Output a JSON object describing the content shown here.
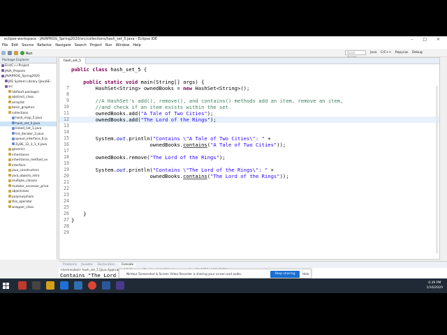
{
  "window": {
    "title": "eclipse-workspace - JAVAPROG_Spring2020/src/collections/hash_set_5.java - Eclipse IDE"
  },
  "menu": [
    "File",
    "Edit",
    "Source",
    "Refactor",
    "Navigate",
    "Search",
    "Project",
    "Run",
    "Window",
    "Help"
  ],
  "toolbar": {
    "run_label": "Run",
    "quick_access_placeholder": "Quick Access",
    "perspectives": [
      "Java",
      "C/C++",
      "Repycas",
      "Debug"
    ]
  },
  "sidebar": {
    "tab_label": "Package Explorer",
    "items": [
      {
        "label": "FirstC++Project",
        "indent": 0,
        "selected": false
      },
      {
        "label": "JAVA_Projects",
        "indent": 0,
        "selected": false
      },
      {
        "label": "JAVAPROG_Spring2020",
        "indent": 0,
        "selected": false
      },
      {
        "label": "JRE System Library [JavaSE-",
        "indent": 1,
        "selected": false
      },
      {
        "label": "src",
        "indent": 1,
        "selected": false
      },
      {
        "label": "(default package)",
        "indent": 2,
        "selected": false
      },
      {
        "label": "abstract_class",
        "indent": 2,
        "selected": false
      },
      {
        "label": "arraylist",
        "indent": 2,
        "selected": false
      },
      {
        "label": "basic_graphics",
        "indent": 2,
        "selected": false
      },
      {
        "label": "collections",
        "indent": 2,
        "selected": false
      },
      {
        "label": "hash_map_5.java",
        "indent": 3,
        "selected": false
      },
      {
        "label": "hash_set_5.java",
        "indent": 3,
        "selected": true
      },
      {
        "label": "linked_list_1.java",
        "indent": 3,
        "selected": false
      },
      {
        "label": "list_iterator_2.java",
        "indent": 3,
        "selected": false
      },
      {
        "label": "queue_interface_6.ja",
        "indent": 3,
        "selected": false
      },
      {
        "label": "ZyDE_12_3_1_4.java",
        "indent": 3,
        "selected": false
      },
      {
        "label": "generics",
        "indent": 2,
        "selected": false
      },
      {
        "label": "inheritance",
        "indent": 2,
        "selected": false
      },
      {
        "label": "inheritance_method_ov",
        "indent": 2,
        "selected": false
      },
      {
        "label": "interface",
        "indent": 2,
        "selected": false
      },
      {
        "label": "java_constructors",
        "indent": 2,
        "selected": false
      },
      {
        "label": "java_objects_intro",
        "indent": 2,
        "selected": false
      },
      {
        "label": "multiple_classes",
        "indent": 2,
        "selected": false
      },
      {
        "label": "mutator_accessor_priva",
        "indent": 2,
        "selected": false
      },
      {
        "label": "objectclass",
        "indent": 2,
        "selected": false
      },
      {
        "label": "polymorphism",
        "indent": 2,
        "selected": false
      },
      {
        "label": "this_operator",
        "indent": 2,
        "selected": false
      },
      {
        "label": "wrapper_class",
        "indent": 2,
        "selected": false
      }
    ]
  },
  "editor": {
    "tab_label": "hash_set_5",
    "lines": [
      {
        "n": "",
        "segs": [
          [
            "kw",
            "public class "
          ],
          [
            "",
            "hash_set_5 {"
          ]
        ]
      },
      {
        "n": "",
        "segs": []
      },
      {
        "n": "",
        "segs": [
          [
            "kw",
            "    public static void "
          ],
          [
            "",
            "main(String[] args) {"
          ]
        ]
      },
      {
        "n": "7",
        "segs": [
          [
            "",
            "        HashSet<String> ownedBooks = "
          ],
          [
            "kw",
            "new "
          ],
          [
            "",
            "HashSet<String>();"
          ]
        ]
      },
      {
        "n": "8",
        "segs": []
      },
      {
        "n": "9",
        "segs": [
          [
            "cm",
            "        //A HashSet's add(), remove(), and contains() methods add an item, remove an item,"
          ]
        ]
      },
      {
        "n": "10",
        "segs": [
          [
            "cm",
            "        //and check if an item exists within the set."
          ]
        ]
      },
      {
        "n": "11",
        "segs": [
          [
            "",
            "        ownedBooks.add("
          ],
          [
            "str",
            "\"A Tale of Two Cities\""
          ],
          [
            "",
            ");"
          ]
        ]
      },
      {
        "n": "12",
        "segs": [
          [
            "",
            "        ownedBooks.add("
          ],
          [
            "str",
            "\"The Lord of the Rings\""
          ],
          [
            "",
            ");"
          ]
        ],
        "hl": true
      },
      {
        "n": "13",
        "segs": []
      },
      {
        "n": "14",
        "segs": []
      },
      {
        "n": "15",
        "segs": [
          [
            "",
            "        System."
          ],
          [
            "itl",
            "out"
          ],
          [
            "",
            ".println("
          ],
          [
            "str",
            "\"Contains \\\"A Tale of Two Cities\\\": \""
          ],
          [
            "",
            " +"
          ]
        ]
      },
      {
        "n": "16",
        "segs": [
          [
            "",
            "                          ownedBooks."
          ],
          [
            "und",
            "contains"
          ],
          [
            "",
            "("
          ],
          [
            "str",
            "\"A Tale of Two Cities\""
          ],
          [
            "",
            "));"
          ]
        ]
      },
      {
        "n": "17",
        "segs": []
      },
      {
        "n": "18",
        "segs": [
          [
            "",
            "        ownedBooks.remove("
          ],
          [
            "str",
            "\"The Lord of the Rings\""
          ],
          [
            "",
            ");"
          ]
        ]
      },
      {
        "n": "19",
        "segs": []
      },
      {
        "n": "19",
        "segs": [
          [
            "",
            "        System."
          ],
          [
            "itl",
            "out"
          ],
          [
            "",
            ".println("
          ],
          [
            "str",
            "\"Contains \\\"The Lord of the Rings\\\": \""
          ],
          [
            "",
            " +"
          ]
        ]
      },
      {
        "n": "20",
        "segs": [
          [
            "",
            "                          ownedBooks."
          ],
          [
            "und",
            "contains"
          ],
          [
            "",
            "("
          ],
          [
            "str",
            "\"The Lord of the Rings\""
          ],
          [
            "",
            "));"
          ]
        ]
      },
      {
        "n": "21",
        "segs": []
      },
      {
        "n": "22",
        "segs": []
      },
      {
        "n": "23",
        "segs": []
      },
      {
        "n": "24",
        "segs": []
      },
      {
        "n": "25",
        "segs": []
      },
      {
        "n": "26",
        "segs": [
          [
            "",
            "    }"
          ]
        ]
      },
      {
        "n": "27",
        "segs": [
          [
            "",
            "}"
          ]
        ]
      },
      {
        "n": "28",
        "segs": []
      },
      {
        "n": "29",
        "segs": []
      }
    ]
  },
  "console": {
    "tabs": [
      "Problems",
      "Javadoc",
      "Declaration",
      "Console"
    ],
    "active_tab": "Console",
    "terminated_line": "<terminated> hash_set_5 [Java Application] C:\\Program Files\\Java\\jdk-12\\bin\\javaw.exe (Jan 16, 2020, 4:36:43 PM)",
    "output": "Contains \"The Lord of the Rings\": false"
  },
  "status": {
    "position": "12 : 20",
    "insert": "Insert"
  },
  "notification": {
    "text": "Nimbus Screenshot & Screen Video Recorder is sharing your screen and audio.",
    "stop_label": "Stop sharing",
    "hide_label": "Hide"
  },
  "tray": {
    "time": "4:39 PM",
    "date": "1/16/2020"
  }
}
